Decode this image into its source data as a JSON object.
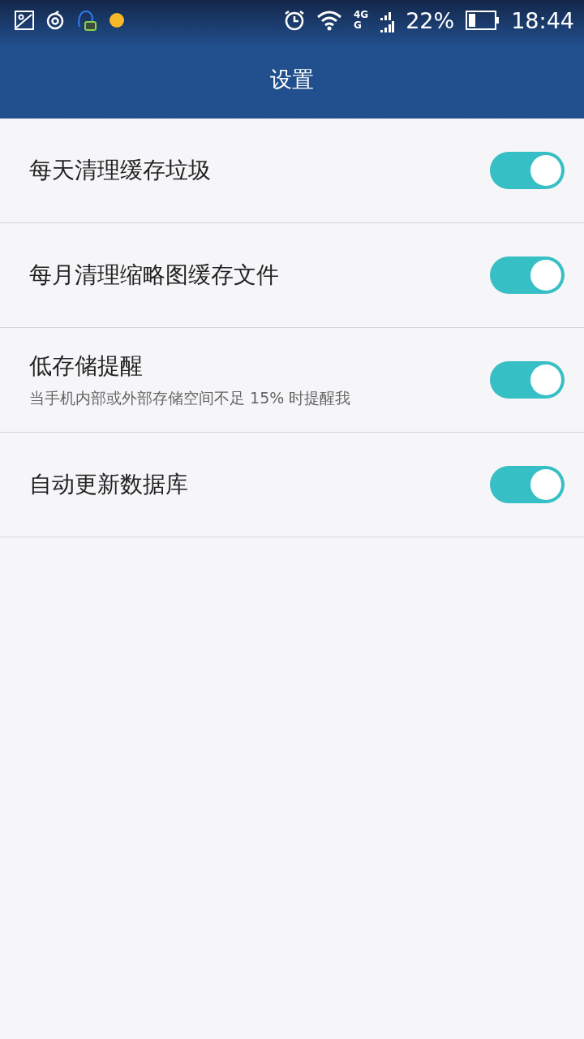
{
  "status_bar": {
    "network_top": "4G",
    "network_bottom": "G",
    "battery": "22%",
    "time": "18:44"
  },
  "header": {
    "title": "设置"
  },
  "settings": [
    {
      "label": "每天清理缓存垃圾",
      "on": true
    },
    {
      "label": "每月清理缩略图缓存文件",
      "on": true
    },
    {
      "label": "低存储提醒",
      "description": "当手机内部或外部存储空间不足 15% 时提醒我",
      "on": true
    },
    {
      "label": "自动更新数据库",
      "on": true
    }
  ]
}
